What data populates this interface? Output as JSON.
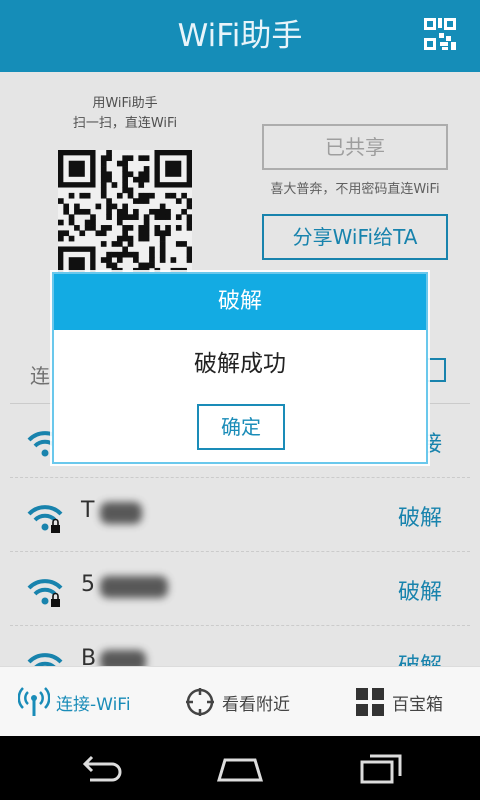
{
  "header": {
    "title": "WiFi助手",
    "qr_icon": "qr-code-icon"
  },
  "share": {
    "caption_line1": "用WiFi助手",
    "caption_line2": "扫一扫，直连WiFi",
    "shared_button": "已共享",
    "shared_hint": "喜大普奔，不用密码直连WiFi",
    "share_button": "分享WiFi给TA"
  },
  "list": {
    "section_title": "连",
    "rows": [
      {
        "name": "",
        "action": "接",
        "locked": false
      },
      {
        "name": "T",
        "action": "破解",
        "locked": true
      },
      {
        "name": "5",
        "action": "破解",
        "locked": true
      },
      {
        "name": "B",
        "action": "破解",
        "locked": false
      }
    ]
  },
  "tabs": {
    "connect": "连接-WiFi",
    "nearby": "看看附近",
    "treasure": "百宝箱"
  },
  "dialog": {
    "title": "破解",
    "message": "破解成功",
    "ok": "确定"
  },
  "colors": {
    "brand": "#158db8",
    "dialog_header": "#13abe3",
    "accent": "#1a8cb8"
  }
}
